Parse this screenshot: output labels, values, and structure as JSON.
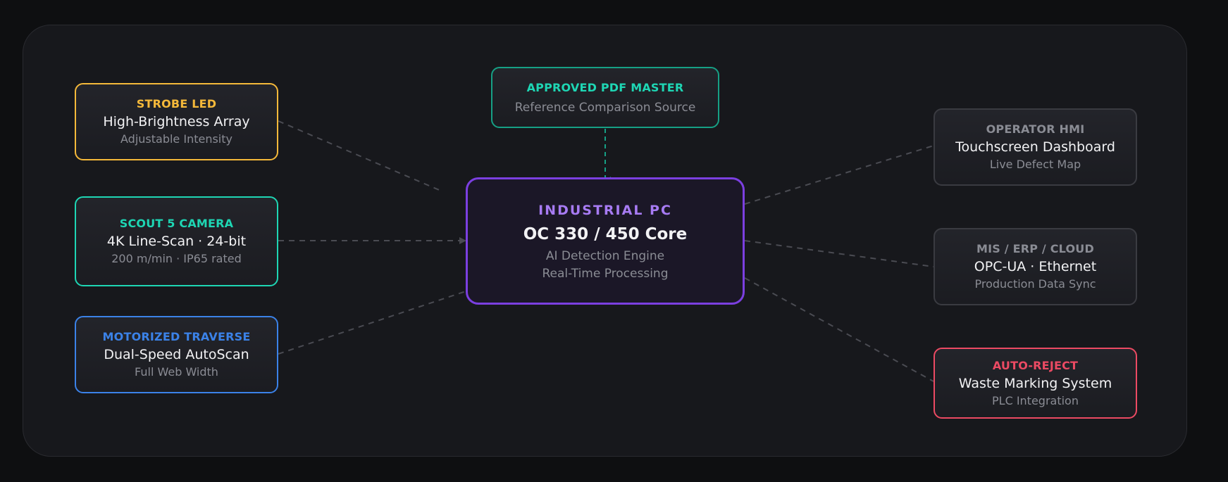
{
  "colors": {
    "strobe": "#f5b93a",
    "camera": "#1ed6b4",
    "traverse": "#3b82e8",
    "core": "#7b3fe0",
    "reference": "#16a085",
    "inactive": "#3a3b41",
    "reject": "#ec4a63",
    "link": "#4a4b52"
  },
  "nodes": {
    "strobe": {
      "title": "STROBE LED",
      "main": "High-Brightness Array",
      "sub": "Adjustable Intensity"
    },
    "camera": {
      "title": "SCOUT 5 CAMERA",
      "main": "4K Line-Scan · 24-bit",
      "sub": "200 m/min · IP65 rated"
    },
    "traverse": {
      "title": "MOTORIZED TRAVERSE",
      "main": "Dual-Speed AutoScan",
      "sub": "Full Web Width"
    },
    "pdf": {
      "title": "APPROVED PDF MASTER",
      "sub": "Reference Comparison Source"
    },
    "pc": {
      "title": "INDUSTRIAL PC",
      "main": "OC 330 / 450 Core",
      "sub1": "AI Detection Engine",
      "sub2": "Real-Time Processing"
    },
    "hmi": {
      "title": "OPERATOR HMI",
      "main": "Touchscreen Dashboard",
      "sub": "Live Defect Map"
    },
    "mis": {
      "title": "MIS / ERP / CLOUD",
      "main": "OPC-UA · Ethernet",
      "sub": "Production Data Sync"
    },
    "reject": {
      "title": "AUTO-REJECT",
      "main": "Waste Marking System",
      "sub": "PLC Integration"
    }
  }
}
